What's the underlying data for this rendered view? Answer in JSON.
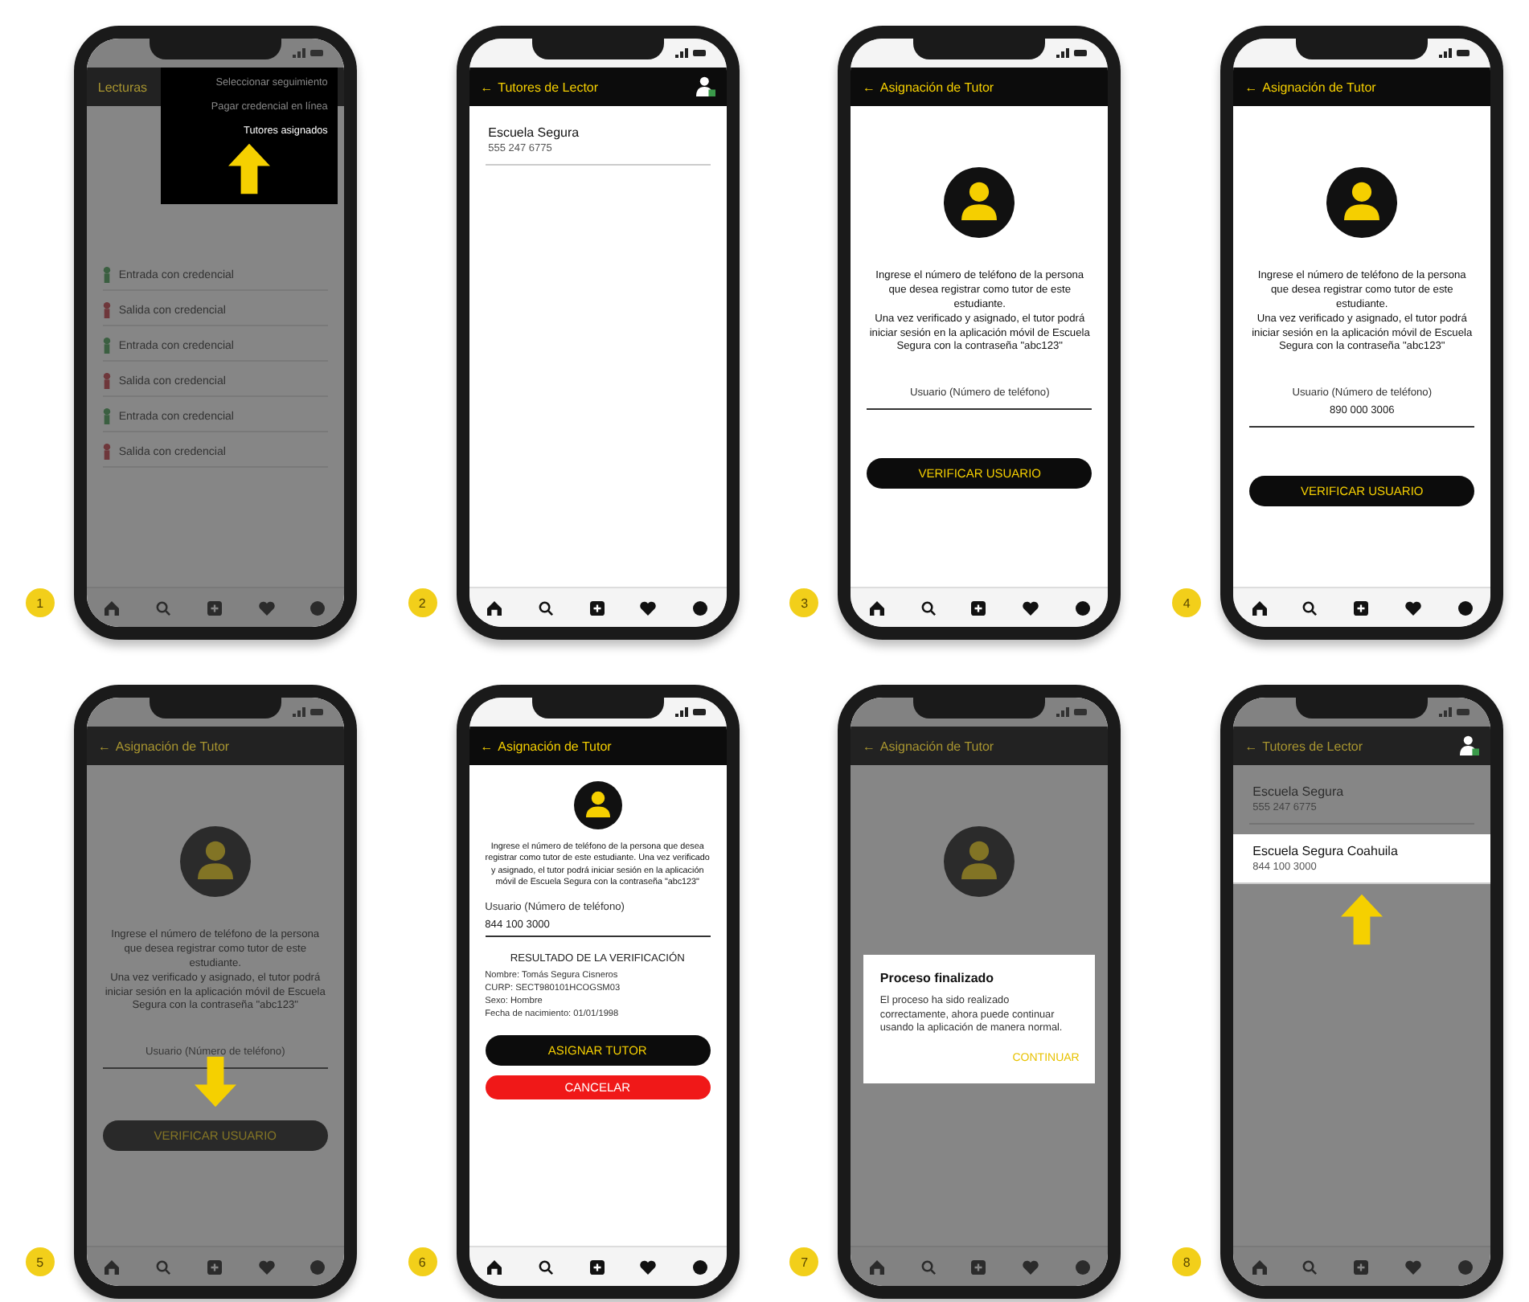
{
  "screens": [
    {
      "number": "1",
      "dimmed": true,
      "dense": false,
      "header": {
        "title": "Lecturas"
      },
      "blocks": [
        {
          "kind": "entry",
          "title": "Entrada con credencial"
        },
        {
          "kind": "exit",
          "title": "Salida con credencial"
        },
        {
          "kind": "entry",
          "title": "Entrada con credencial"
        },
        {
          "kind": "exit",
          "title": "Salida con credencial"
        },
        {
          "kind": "entry",
          "title": "Entrada con credencial"
        },
        {
          "kind": "exit",
          "title": "Salida con credencial"
        }
      ],
      "menu": {
        "items": [
          {
            "label": "Seleccionar seguimiento",
            "selected": false
          },
          {
            "label": "Pagar credencial en línea",
            "selected": false
          },
          {
            "label": "Tutores asignados",
            "selected": true
          }
        ],
        "pointer": true
      }
    },
    {
      "number": "2",
      "dimmed": false,
      "dense": false,
      "header": {
        "back": "←",
        "title": "Tutores de Lector",
        "add_person": true
      },
      "blocks": [
        {
          "kind": "list_item",
          "title": "Escuela Segura",
          "subtitle": "555 247 6775",
          "raised": false
        }
      ]
    },
    {
      "number": "3",
      "dimmed": false,
      "dense": false,
      "header": {
        "back": "←",
        "title": "Asignación de Tutor",
        "add_person": false
      },
      "blocks": [
        {
          "kind": "avatar"
        },
        {
          "kind": "paragraph",
          "text": "Ingrese el número de teléfono de la persona que desea registrar como tutor de este estudiante.\nUna vez verificado y asignado, el tutor podrá iniciar sesión en la aplicación móvil de Escuela Segura con la contraseña \"abc123\""
        },
        {
          "kind": "field",
          "placeholder": "Usuario (Número de teléfono)"
        },
        {
          "kind": "button",
          "label": "VERIFICAR USUARIO"
        }
      ]
    },
    {
      "number": "4",
      "dimmed": false,
      "dense": false,
      "header": {
        "back": "←",
        "title": "Asignación de Tutor",
        "add_person": false
      },
      "blocks": [
        {
          "kind": "avatar"
        },
        {
          "kind": "paragraph",
          "text": "Ingrese el número de teléfono de la persona que desea registrar como tutor de este estudiante.\nUna vez verificado y asignado, el tutor podrá iniciar sesión en la aplicación móvil de Escuela Segura con la contraseña \"abc123\""
        },
        {
          "kind": "field",
          "label": "Usuario (Número de teléfono)",
          "value": "890 000 3006"
        },
        {
          "kind": "button",
          "label": "VERIFICAR USUARIO"
        }
      ]
    },
    {
      "number": "5",
      "dimmed": true,
      "dense": false,
      "header": {
        "back": "←",
        "title": "Asignación de Tutor",
        "add_person": false
      },
      "blocks": [
        {
          "kind": "avatar"
        },
        {
          "kind": "paragraph",
          "text": "Ingrese el número de teléfono de la persona que desea registrar como tutor de este estudiante.\nUna vez verificado y asignado, el tutor podrá iniciar sesión en la aplicación móvil de Escuela Segura con la contraseña \"abc123\""
        },
        {
          "kind": "field",
          "placeholder": "Usuario (Número de teléfono)"
        },
        {
          "kind": "down_arrow"
        },
        {
          "kind": "button",
          "label": "VERIFICAR USUARIO"
        }
      ]
    },
    {
      "number": "6",
      "dimmed": false,
      "dense": true,
      "header": {
        "back": "←",
        "title": "Asignación de Tutor",
        "add_person": false
      },
      "blocks": [
        {
          "kind": "avatar"
        },
        {
          "kind": "paragraph",
          "text": "Ingrese el número de teléfono de la persona que desea registrar como tutor de este estudiante. Una vez verificado y asignado, el tutor podrá iniciar sesión en la aplicación móvil de Escuela Segura con la contraseña \"abc123\""
        },
        {
          "kind": "field",
          "label": "Usuario (Número de teléfono)",
          "value": "844 100 3000"
        },
        {
          "kind": "heading",
          "text": "RESULTADO DE LA VERIFICACIÓN"
        },
        {
          "kind": "line",
          "text": "Nombre: Tomás Segura Cisneros"
        },
        {
          "kind": "line",
          "text": "CURP: SECT980101HCOGSM03"
        },
        {
          "kind": "line",
          "text": "Sexo: Hombre"
        },
        {
          "kind": "line",
          "text": "Fecha de nacimiento: 01/01/1998"
        },
        {
          "kind": "button",
          "label": "ASIGNAR TUTOR"
        },
        {
          "kind": "cancel_button",
          "label": "CANCELAR"
        }
      ]
    },
    {
      "number": "7",
      "dimmed": true,
      "dense": false,
      "header": {
        "back": "←",
        "title": "Asignación de Tutor",
        "add_person": false
      },
      "blocks": [
        {
          "kind": "avatar"
        }
      ],
      "dialog": {
        "title": "Proceso finalizado",
        "text": "El proceso ha sido realizado correctamente, ahora puede continuar usando la aplicación de manera normal.",
        "action": "CONTINUAR"
      }
    },
    {
      "number": "8",
      "dimmed": true,
      "dense": false,
      "header": {
        "back": "←",
        "title": "Tutores de Lector",
        "add_person": true
      },
      "blocks": [
        {
          "kind": "list_item",
          "title": "Escuela Segura",
          "subtitle": "555 247 6775",
          "raised": false
        },
        {
          "kind": "list_item",
          "title": "Escuela Segura Coahuila",
          "subtitle": "844 100 3000",
          "raised": true
        },
        {
          "kind": "up_arrow"
        }
      ]
    }
  ]
}
